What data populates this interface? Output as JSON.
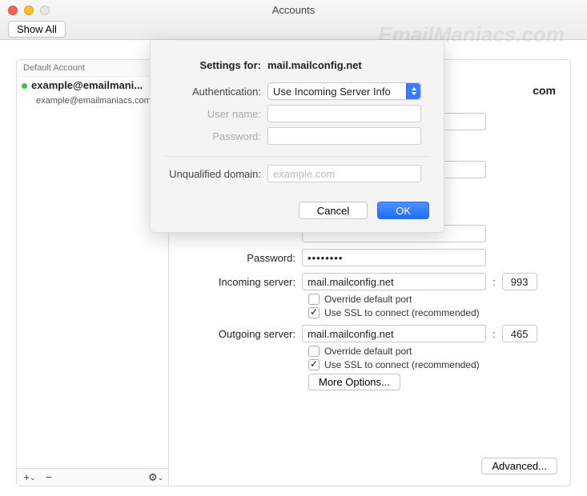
{
  "window": {
    "title": "Accounts",
    "show_all": "Show All"
  },
  "watermark": "EmailManiacs.com",
  "sidebar": {
    "header": "Default Account",
    "account_name": "example@emailmani...",
    "account_email": "example@emailmaniacs.com",
    "add_icon": "+",
    "remove_icon": "−",
    "dropdown_icon": "⌄",
    "gear_icon": "⚙︎",
    "gear_caret": "⌄"
  },
  "right_peek": "com",
  "form": {
    "password_label": "Password:",
    "password_value": "••••••••",
    "incoming_label": "Incoming server:",
    "incoming_value": "mail.mailconfig.net",
    "incoming_port": "993",
    "override_label": "Override default port",
    "ssl_label": "Use SSL to connect (recommended)",
    "outgoing_label": "Outgoing server:",
    "outgoing_value": "mail.mailconfig.net",
    "outgoing_port": "465",
    "more_options": "More Options...",
    "advanced": "Advanced..."
  },
  "sheet": {
    "settings_for_label": "Settings for:",
    "settings_for_value": "mail.mailconfig.net",
    "auth_label": "Authentication:",
    "auth_value": "Use Incoming Server Info",
    "user_label": "User name:",
    "pass_label": "Password:",
    "domain_label": "Unqualified domain:",
    "domain_placeholder": "example.com",
    "cancel": "Cancel",
    "ok": "OK"
  }
}
